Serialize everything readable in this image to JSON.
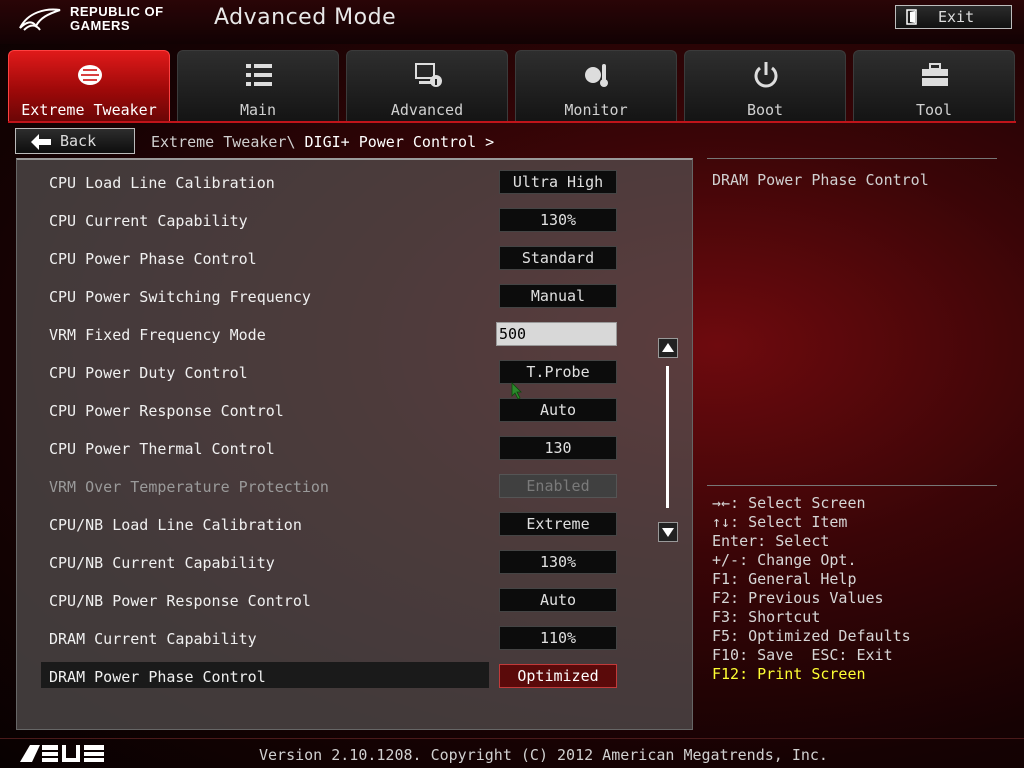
{
  "header": {
    "brand_line1": "REPUBLIC OF",
    "brand_line2": "GAMERS",
    "mode_title": "Advanced Mode",
    "exit_label": "Exit"
  },
  "tabs": [
    {
      "label": "Extreme Tweaker",
      "icon": "tweaker-icon",
      "active": true
    },
    {
      "label": "Main",
      "icon": "list-icon",
      "active": false
    },
    {
      "label": "Advanced",
      "icon": "advanced-icon",
      "active": false
    },
    {
      "label": "Monitor",
      "icon": "monitor-icon",
      "active": false
    },
    {
      "label": "Boot",
      "icon": "power-icon",
      "active": false
    },
    {
      "label": "Tool",
      "icon": "toolbox-icon",
      "active": false
    }
  ],
  "breadcrumb": {
    "back_label": "Back",
    "path": "Extreme Tweaker\\ ",
    "current": "DIGI+ Power Control >"
  },
  "settings": [
    {
      "name": "CPU Load Line Calibration",
      "value": "Ultra High"
    },
    {
      "name": "CPU Current Capability",
      "value": "130%"
    },
    {
      "name": "CPU Power Phase Control",
      "value": "Standard"
    },
    {
      "name": "CPU Power Switching Frequency",
      "value": "Manual"
    },
    {
      "name": "VRM Fixed Frequency Mode",
      "value": "500"
    },
    {
      "name": "CPU Power Duty Control",
      "value": "T.Probe"
    },
    {
      "name": "CPU Power Response Control",
      "value": "Auto"
    },
    {
      "name": "CPU Power Thermal Control",
      "value": "130"
    },
    {
      "name": "VRM Over Temperature Protection",
      "value": "Enabled"
    },
    {
      "name": "CPU/NB Load Line Calibration",
      "value": "Extreme"
    },
    {
      "name": "CPU/NB Current Capability",
      "value": "130%"
    },
    {
      "name": "CPU/NB Power Response Control",
      "value": "Auto"
    },
    {
      "name": "DRAM Current Capability",
      "value": "110%"
    },
    {
      "name": "DRAM Power Phase Control",
      "value": "Optimized"
    }
  ],
  "help": {
    "description": "DRAM Power Phase Control",
    "keys": [
      "→←: Select Screen",
      "↑↓: Select Item",
      "Enter: Select",
      "+/-: Change Opt.",
      "F1: General Help",
      "F2: Previous Values",
      "F3: Shortcut",
      "F5: Optimized Defaults",
      "F10: Save  ESC: Exit",
      "F12: Print Screen"
    ]
  },
  "footer": {
    "version": "Version 2.10.1208. Copyright (C) 2012 American Megatrends, Inc."
  },
  "colors": {
    "accent": "#c0141a",
    "highlight_key": "#ffff33"
  }
}
